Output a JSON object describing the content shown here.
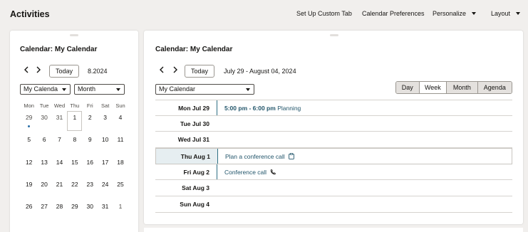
{
  "header": {
    "title": "Activities",
    "links": {
      "custom_tab": "Set Up Custom Tab",
      "preferences": "Calendar Preferences",
      "personalize": "Personalize",
      "layout": "Layout"
    }
  },
  "mini_panel": {
    "title": "Calendar: My Calendar",
    "prev_icon": "chevron-left-icon",
    "next_icon": "chevron-right-icon",
    "today_label": "Today",
    "month_label": "8.2024",
    "calendar_select": "My Calenda",
    "view_select": "Month",
    "weekdays": [
      "Mon",
      "Tue",
      "Wed",
      "Thu",
      "Fri",
      "Sat",
      "Sun"
    ],
    "weeks": [
      [
        "29",
        "30",
        "31",
        "1",
        "2",
        "3",
        "4"
      ],
      [
        "5",
        "6",
        "7",
        "8",
        "9",
        "10",
        "11"
      ],
      [
        "12",
        "13",
        "14",
        "15",
        "16",
        "17",
        "18"
      ],
      [
        "19",
        "20",
        "21",
        "22",
        "23",
        "24",
        "25"
      ],
      [
        "26",
        "27",
        "28",
        "29",
        "30",
        "31",
        "1"
      ]
    ]
  },
  "main_panel": {
    "title": "Calendar: My Calendar",
    "prev_icon": "chevron-left-icon",
    "next_icon": "chevron-right-icon",
    "today_label": "Today",
    "range_label": "July 29 - August 04, 2024",
    "calendar_select": "My Calendar",
    "views": {
      "day": "Day",
      "week": "Week",
      "month": "Month",
      "agenda": "Agenda"
    },
    "active_view": "Week",
    "days": [
      {
        "label": "Mon Jul 29",
        "event_time": "5:00 pm - 6:00 pm",
        "event_title": "Planning"
      },
      {
        "label": "Tue Jul 30"
      },
      {
        "label": "Wed Jul 31"
      },
      {
        "label": "Thu Aug 1",
        "event_title": "Plan a conference call",
        "icon": "clipboard-icon"
      },
      {
        "label": "Fri Aug 2",
        "event_title": "Conference call",
        "icon": "phone-icon"
      },
      {
        "label": "Sat Aug 3"
      },
      {
        "label": "Sun Aug 4"
      }
    ]
  },
  "colors": {
    "accent": "#23566b",
    "event_dot": "#2a6fa8",
    "current_day_bg": "#e6eef1"
  }
}
